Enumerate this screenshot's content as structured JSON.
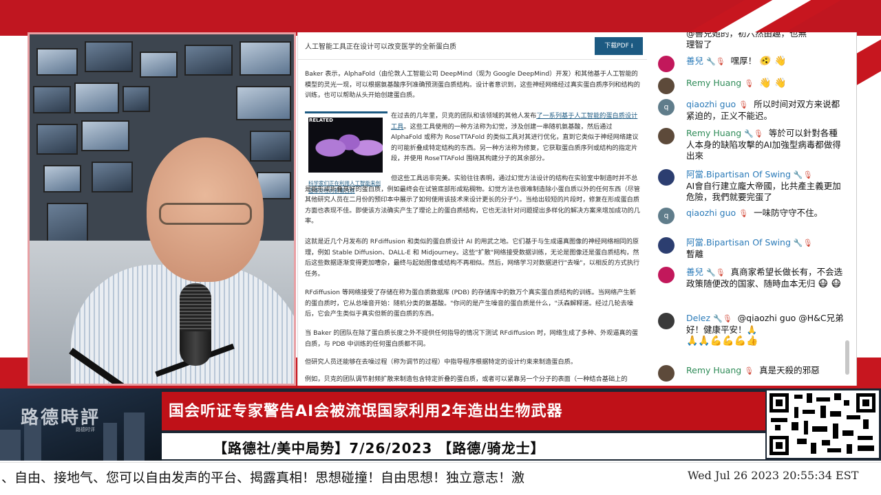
{
  "article": {
    "title": "人工智能工具正在设计可以改变医学的全新蛋白质",
    "pdf_button": "下载PDF ⭳",
    "p1": "Baker 表示，AlphaFold（由伦敦人工智能公司 DeepMind（现为 Google DeepMind）开发）和其他基于人工智能的模型的灵光一现，可以根据氨基酸序列准确预测蛋白质结构。设计者意识到，这些神经网络经过真实蛋白质序列和结构的训练，也可以帮助从头开始创建蛋白质。",
    "related_tag": "RELATED",
    "related_caption": "科学家们正在利用人工智能来创造革命性的新蛋白质",
    "p2_pre": "在过去的几年里，贝克的团队和该领域的其他人发布",
    "p2_link": "了一系列基于人工智能的蛋白质设计工具",
    "p2_post": "。这些工具使用的一种方法称为幻觉，涉及创建一串随机氨基酸，然后通过 AlphaFold 或称为 RoseTTAFold 的类似工具对其进行优化，直到它类似于神经网络建议的可能折叠成特定结构的东西。另一种方法称为修复，它获取蛋白质序列或结构的指定片段，并使用 RoseTTAFold 围绕其构建分子的其余部分。",
    "p3": "但这些工具远非完美。实验往往表明，通过幻觉方法设计的结构在实验室中制造时并不总是能形成折叠良好的蛋白质，例如最终会在试管底部形成粘稠物。幻觉方法也很难制造除小蛋白质以外的任何东西（尽管其他研究人员在二月份的预印本中展示了如何使用该技术来设计更长的分子⁴）。当给出较短的片段时，修复在形成蛋白质方面也表现不佳。即使该方法确实产生了理论上的蛋白质结构，它也无法针对问题提出多样化的解决方案来增加成功的几率。",
    "p4": "这就是近几个月发布的 RFdiffusion 和类似的蛋白质设计 AI 的用武之地。它们基于与生成逼真图像的神经网络相同的原理，例如 Stable Diffusion、DALL-E 和 Midjourney。这些\"扩散\"网络接受数据训练，无论是图像还是蛋白质结构，然后这些数据逐渐变得更加嘈杂，最终与起始图像或结构不再相似。然后，网络学习对数据进行\"去噪\"，以相反的方式执行任务。",
    "p5": "RFdiffusion 等网络接受了存储在称为蛋白质数据库 (PDB) 的存储库中的数万个真实蛋白质结构的训练。当网络产生新的蛋白质时，它从总噪音开始：随机分类的氨基酸。\"你问的是产生噪音的蛋白质是什么，\"沃森解释道。经过几轮去噪后，它会产生类似于真实但新的蛋白质的东西。",
    "p6": "当 Baker 的团队在除了蛋白质长度之外不提供任何指导的情况下测试 RFdiffusion 时，网络生成了多种、外观逼真的蛋白质，与 PDB 中训练的任何蛋白质都不同。",
    "p7": "但研究人员还能够在去噪过程（称为调节的过程）中指导程序根据特定的设计约束来制造蛋白质。",
    "p8": "例如，贝克的团队调节射频扩散来制造包含特定折叠的蛋白质，或者可以紧靠另一个分子的表面（一种结合基础上的"
  },
  "chat": {
    "top_partial": "@善兒她的，初六然由趣，也無",
    "top_partial2": "理智了",
    "messages": [
      {
        "user": "善兒",
        "icons": "🔧 🎙",
        "text": "嘿厚！",
        "emoji": "🫨 👋",
        "avatar_color": "#c2185b",
        "avatar_letter": ""
      },
      {
        "user": "Remy Huang",
        "icons": "🎙",
        "text": "",
        "emoji": "👋 👋",
        "avatar_color": "#5d4a3a",
        "avatar_letter": "",
        "owner": "true"
      },
      {
        "user": "qiaozhi guo",
        "icons": "🎙",
        "text": "所以时间对双方来说都紧迫的，正义不能迟。",
        "emoji": "",
        "avatar_color": "#607d8b",
        "avatar_letter": "q"
      },
      {
        "user": "Remy Huang",
        "icons": "🔧 🎙",
        "text": "等於可以針對各種人本身的缺陷攻擊的AI加強型病毒都做得出來",
        "emoji": "",
        "avatar_color": "#5d4a3a",
        "avatar_letter": "",
        "owner": "true"
      },
      {
        "user": "阿當.Bipartisan Of Swing",
        "icons": "🔧 🎙",
        "text": "AI會自行建立龐大帝國，比共產主義更加危險，我們就要完蛋了",
        "emoji": "",
        "avatar_color": "#2c3e70",
        "avatar_letter": ""
      },
      {
        "user": "qiaozhi guo",
        "icons": "🎙",
        "text": "一味防守守不住。",
        "emoji": "",
        "avatar_color": "#607d8b",
        "avatar_letter": "q"
      },
      {
        "user": "阿當.Bipartisan Of Swing",
        "icons": "🔧 🎙",
        "text": "暫離",
        "emoji": "",
        "avatar_color": "#2c3e70",
        "avatar_letter": ""
      },
      {
        "user": "善兒",
        "icons": "🔧 🎙",
        "text": "真商家希望长做长有，不会选政策随便改的国家、随時血本无归",
        "emoji": "😷 😷",
        "avatar_color": "#c2185b",
        "avatar_letter": ""
      },
      {
        "user": "Delez",
        "icons": "🔧 🎙",
        "text": "@qiaozhi guo @H&C兄弟好！健康平安！🙏",
        "emoji": "🙏🙏💪💪💪👍",
        "avatar_color": "#3a3a3a",
        "avatar_letter": ""
      },
      {
        "user": "Remy Huang",
        "icons": "🎙",
        "text": "真是天殺的邪惡",
        "emoji": "",
        "avatar_color": "#5d4a3a",
        "avatar_letter": "",
        "owner": "true"
      }
    ]
  },
  "lower_third": {
    "logo": "路德時評",
    "logo_sub": "路德时评",
    "headline": "国会听证专家警告AI会被流氓国家利用2年造出生物武器",
    "subline": "【路德社/美中局势】7/26/2023 【路德/骑龙士】"
  },
  "ticker": {
    "text": "、自由、接地气、您可以自由发声的平台、揭露真相！思想碰撞！自由思想！独立意志！激",
    "clock": "Wed Jul 26 2023 20:55:34 EST"
  },
  "colors": {
    "brand_red": "#bf1118",
    "link_blue": "#1c5a82",
    "owner_green": "#2e8b57",
    "chat_name_blue": "#2a7ab8"
  }
}
